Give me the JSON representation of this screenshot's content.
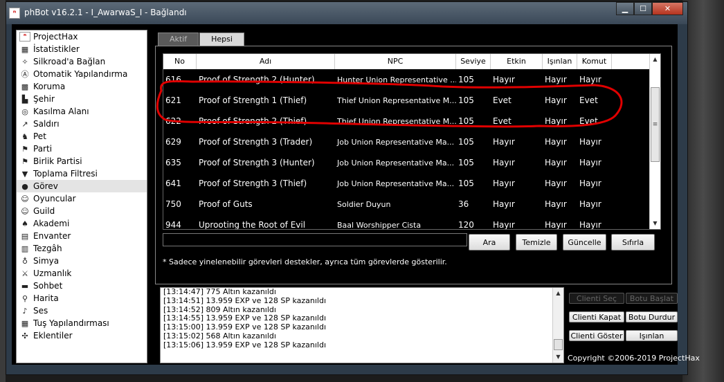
{
  "window": {
    "title": "phBot v16.2.1 - I_AwarwaS_I - Bağlandı",
    "app_icon": "phbot-icon"
  },
  "sidebar": {
    "items": [
      {
        "label": "ProjectHax",
        "icon": "projecthax-icon",
        "glyph": "ⁿ",
        "red": true
      },
      {
        "label": "İstatistikler",
        "icon": "statistics-icon",
        "glyph": "▦"
      },
      {
        "label": "Silkroad'a Bağlan",
        "icon": "connect-icon",
        "glyph": "✧"
      },
      {
        "label": "Otomatik Yapılandırma",
        "icon": "autoconfig-icon",
        "glyph": "Ⓐ"
      },
      {
        "label": "Koruma",
        "icon": "protection-icon",
        "glyph": "▩"
      },
      {
        "label": "Şehir",
        "icon": "town-icon",
        "glyph": "▙"
      },
      {
        "label": "Kasılma Alanı",
        "icon": "training-area-icon",
        "glyph": "◎"
      },
      {
        "label": "Saldırı",
        "icon": "attack-icon",
        "glyph": "↗"
      },
      {
        "label": "Pet",
        "icon": "pet-icon",
        "glyph": "♞"
      },
      {
        "label": "Parti",
        "icon": "party-icon",
        "glyph": "⚑"
      },
      {
        "label": "Birlik Partisi",
        "icon": "union-party-icon",
        "glyph": "⚑"
      },
      {
        "label": "Toplama Filtresi",
        "icon": "filter-icon",
        "glyph": "▼"
      },
      {
        "label": "Görev",
        "icon": "quest-icon",
        "glyph": "●",
        "active": true
      },
      {
        "label": "Oyuncular",
        "icon": "players-icon",
        "glyph": "☺"
      },
      {
        "label": "Guild",
        "icon": "guild-icon",
        "glyph": "☺"
      },
      {
        "label": "Akademi",
        "icon": "academy-icon",
        "glyph": "♠"
      },
      {
        "label": "Envanter",
        "icon": "inventory-icon",
        "glyph": "▤"
      },
      {
        "label": "Tezgâh",
        "icon": "stall-icon",
        "glyph": "▥"
      },
      {
        "label": "Simya",
        "icon": "alchemy-icon",
        "glyph": "♁"
      },
      {
        "label": "Uzmanlık",
        "icon": "mastery-icon",
        "glyph": "⚔"
      },
      {
        "label": "Sohbet",
        "icon": "chat-icon",
        "glyph": "▬"
      },
      {
        "label": "Harita",
        "icon": "map-pin-icon",
        "glyph": "⚲"
      },
      {
        "label": "Ses",
        "icon": "bell-icon",
        "glyph": "♪"
      },
      {
        "label": "Tuş Yapılandırması",
        "icon": "keyboard-icon",
        "glyph": "▦"
      },
      {
        "label": "Eklentiler",
        "icon": "plugins-icon",
        "glyph": "✣"
      }
    ]
  },
  "tabs": [
    {
      "label": "Aktif",
      "active": true
    },
    {
      "label": "Hepsi",
      "active": false
    }
  ],
  "table": {
    "columns": [
      "No",
      "Adı",
      "NPC",
      "Seviye",
      "Etkin",
      "Işınlan",
      "Komut"
    ],
    "rows": [
      [
        "616",
        "Proof of Strength 2 (Hunter)",
        "Hunter Union  Representative ...",
        "105",
        "Hayır",
        "Hayır",
        "Hayır"
      ],
      [
        "621",
        "Proof of Strength 1 (Thief)",
        "Thief Union Representative M...",
        "105",
        "Evet",
        "Hayır",
        "Evet"
      ],
      [
        "622",
        "Proof of Strength 2 (Thief)",
        "Thief Union Representative M...",
        "105",
        "Evet",
        "Hayır",
        "Evet"
      ],
      [
        "629",
        "Proof of Strength 3 (Trader)",
        "Job Union Representative Ma...",
        "105",
        "Hayır",
        "Hayır",
        "Hayır"
      ],
      [
        "635",
        "Proof of Strength 3 (Hunter)",
        "Job Union Representative Ma...",
        "105",
        "Hayır",
        "Hayır",
        "Hayır"
      ],
      [
        "641",
        "Proof of Strength 3 (Thief)",
        "Job Union Representative Ma...",
        "105",
        "Hayır",
        "Hayır",
        "Hayır"
      ],
      [
        "750",
        "Proof of Guts",
        "Soldier Duyun",
        "36",
        "Hayır",
        "Hayır",
        "Hayır"
      ],
      [
        "944",
        "Uprooting the Root of Evil",
        "Baal Worshipper Cista",
        "120",
        "Hayır",
        "Hayır",
        "Hayır"
      ]
    ]
  },
  "search": {
    "value": "",
    "placeholder": ""
  },
  "buttons": {
    "search": "Ara",
    "clear": "Temizle",
    "update": "Güncelle",
    "reset": "Sıfırla"
  },
  "note": "* Sadece yinelenebilir görevleri destekler, ayrıca tüm görevlerde gösterilir.",
  "log": [
    "[13:14:47] 775 Altın kazanıldı",
    "[13:14:51] 13.959 EXP ve 128 SP kazanıldı",
    "[13:14:52] 809 Altın kazanıldı",
    "[13:14:55] 13.959 EXP ve 128 SP kazanıldı",
    "[13:15:00] 13.959 EXP ve 128 SP kazanıldı",
    "[13:15:02] 568 Altın kazanıldı",
    "[13:15:06] 13.959 EXP ve 128 SP kazanıldı"
  ],
  "side_buttons": {
    "select_client": "Clienti Seç",
    "start_bot": "Botu Başlat",
    "close_client": "Clienti Kapat",
    "stop_bot": "Botu Durdur",
    "show_client": "Clienti Göster",
    "teleport": "Işınlan"
  },
  "copyright": "Copyright ©2006-2019 ProjectHax",
  "colors": {
    "annotation": "#e00000",
    "background": "#000000",
    "titlebar": "#3a4857"
  }
}
